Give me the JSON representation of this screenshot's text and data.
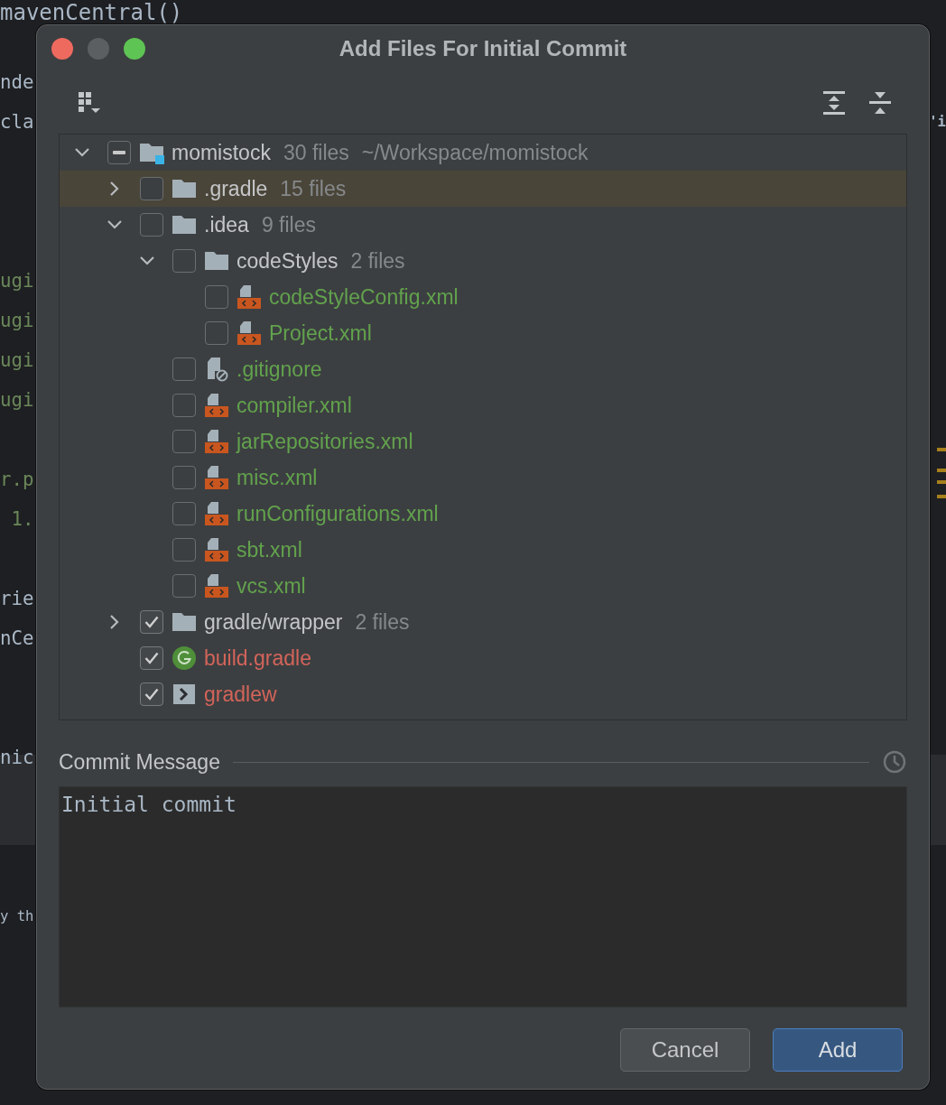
{
  "editor": {
    "left_lines": [
      {
        "text": "mavenCentral()",
        "color": "#a9b7c6"
      },
      {
        "text": "nde",
        "color": "#a9b7c6"
      },
      {
        "text": "cla",
        "color": "#a9b7c6"
      },
      {
        "text": "ugi",
        "color": "#6a8759"
      },
      {
        "text": "ugi",
        "color": "#6a8759"
      },
      {
        "text": "ugi",
        "color": "#6a8759"
      },
      {
        "text": "ugi",
        "color": "#6a8759"
      },
      {
        "text": "r.p",
        "color": "#6a8759"
      },
      {
        "text": " 1.",
        "color": "#6a8759"
      },
      {
        "text": "rie",
        "color": "#a9b7c6"
      },
      {
        "text": "nCe",
        "color": "#a9b7c6"
      },
      {
        "text": "nic",
        "color": "#a9b7c6"
      },
      {
        "text": "y th",
        "color": "#a9b7c6"
      }
    ],
    "right_lines": [
      {
        "text": "'i",
        "color": "#a9b7c6"
      }
    ]
  },
  "dialog": {
    "title": "Add Files For Initial Commit",
    "tree": {
      "items": [
        {
          "name": "momistock",
          "count": "30 files",
          "path": "~/Workspace/momistock",
          "kind": "module",
          "color": "#c4c6c8",
          "checked": false,
          "indeterminate": true,
          "expanded": true,
          "selected": false,
          "children": [
            {
              "name": ".gradle",
              "count": "15 files",
              "kind": "folder",
              "color": "#c4c6c8",
              "checked": false,
              "indeterminate": false,
              "expanded": false,
              "selected": true
            },
            {
              "name": ".idea",
              "count": "9 files",
              "kind": "folder",
              "color": "#c4c6c8",
              "checked": false,
              "indeterminate": false,
              "expanded": true,
              "selected": false,
              "children": [
                {
                  "name": "codeStyles",
                  "count": "2 files",
                  "kind": "folder",
                  "color": "#c4c6c8",
                  "checked": false,
                  "indeterminate": false,
                  "expanded": true,
                  "selected": false,
                  "children": [
                    {
                      "name": "codeStyleConfig.xml",
                      "kind": "xml",
                      "color": "#62a24d",
                      "checked": false,
                      "indeterminate": false,
                      "selected": false
                    },
                    {
                      "name": "Project.xml",
                      "kind": "xml",
                      "color": "#62a24d",
                      "checked": false,
                      "indeterminate": false,
                      "selected": false
                    }
                  ]
                },
                {
                  "name": ".gitignore",
                  "kind": "ignore",
                  "color": "#62a24d",
                  "checked": false,
                  "indeterminate": false,
                  "selected": false
                },
                {
                  "name": "compiler.xml",
                  "kind": "xml",
                  "color": "#62a24d",
                  "checked": false,
                  "indeterminate": false,
                  "selected": false
                },
                {
                  "name": "jarRepositories.xml",
                  "kind": "xml",
                  "color": "#62a24d",
                  "checked": false,
                  "indeterminate": false,
                  "selected": false
                },
                {
                  "name": "misc.xml",
                  "kind": "xml",
                  "color": "#62a24d",
                  "checked": false,
                  "indeterminate": false,
                  "selected": false
                },
                {
                  "name": "runConfigurations.xml",
                  "kind": "xml",
                  "color": "#62a24d",
                  "checked": false,
                  "indeterminate": false,
                  "selected": false
                },
                {
                  "name": "sbt.xml",
                  "kind": "xml",
                  "color": "#62a24d",
                  "checked": false,
                  "indeterminate": false,
                  "selected": false
                },
                {
                  "name": "vcs.xml",
                  "kind": "xml",
                  "color": "#62a24d",
                  "checked": false,
                  "indeterminate": false,
                  "selected": false
                }
              ]
            },
            {
              "name": "gradle/wrapper",
              "count": "2 files",
              "kind": "folder",
              "color": "#c4c6c8",
              "checked": true,
              "indeterminate": false,
              "expanded": false,
              "selected": false
            },
            {
              "name": "build.gradle",
              "kind": "gradle",
              "color": "#d3645a",
              "checked": true,
              "indeterminate": false,
              "selected": false
            },
            {
              "name": "gradlew",
              "kind": "script",
              "color": "#d3645a",
              "checked": true,
              "indeterminate": false,
              "selected": false
            }
          ]
        }
      ]
    },
    "commit_message": {
      "label": "Commit Message",
      "value": "Initial commit"
    },
    "buttons": [
      {
        "label": "Cancel",
        "kind": "secondary"
      },
      {
        "label": "Add",
        "kind": "primary"
      }
    ]
  }
}
